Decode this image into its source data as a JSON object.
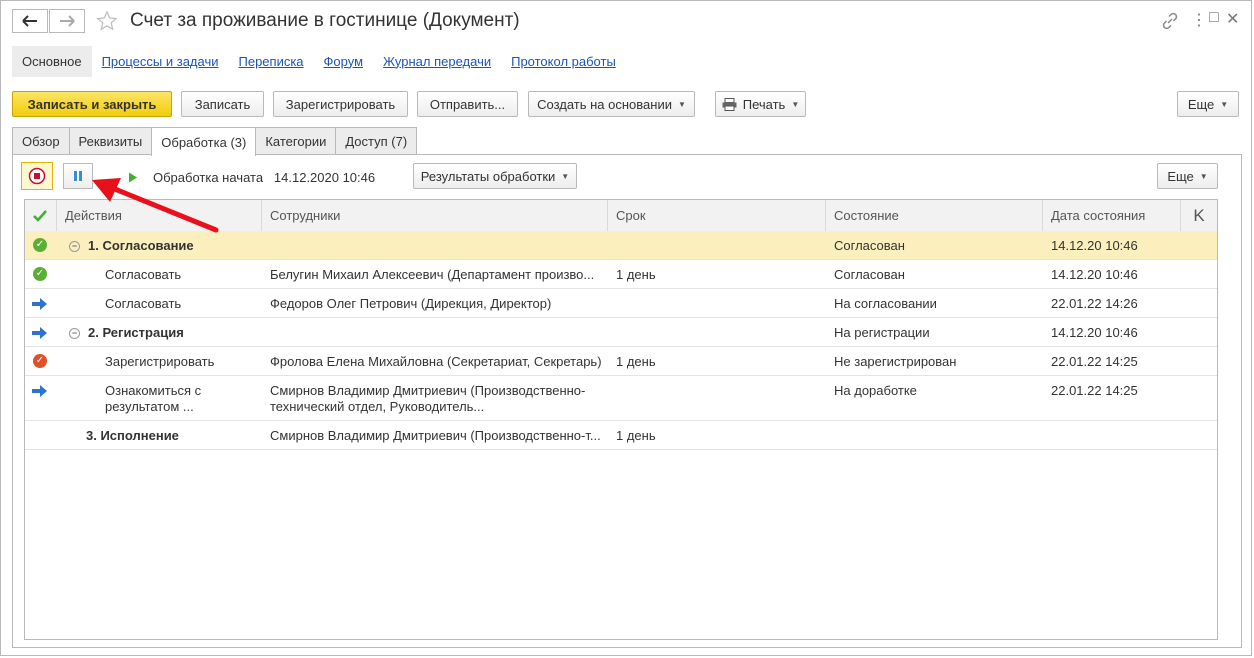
{
  "window": {
    "title": "Счет за проживание в гостинице (Документ)"
  },
  "section_tabs": [
    "Основное",
    "Процессы и задачи",
    "Переписка",
    "Форум",
    "Журнал передачи",
    "Протокол работы"
  ],
  "toolbar": {
    "save_close": "Записать и закрыть",
    "save": "Записать",
    "register": "Зарегистрировать",
    "send": "Отправить...",
    "create_based": "Создать на основании",
    "print": "Печать",
    "more": "Еще"
  },
  "tabs": [
    "Обзор",
    "Реквизиты",
    "Обработка (3)",
    "Категории",
    "Доступ (7)"
  ],
  "processing": {
    "status_label": "Обработка начата",
    "status_date": "14.12.2020 10:46",
    "results_button": "Результаты обработки",
    "more": "Еще"
  },
  "table": {
    "headers": [
      "Действия",
      "Сотрудники",
      "Срок",
      "Состояние",
      "Дата состояния",
      "K"
    ],
    "rows": [
      {
        "icon": "ok",
        "action": "1. Согласование",
        "employee": "",
        "term": "",
        "state": "Согласован",
        "date": "14.12.20 10:46"
      },
      {
        "icon": "ok",
        "action": "Согласовать",
        "employee": "Белугин Михаил Алексеевич (Департамент произво...",
        "term": "1 день",
        "state": "Согласован",
        "date": "14.12.20 10:46"
      },
      {
        "icon": "arrow",
        "action": "Согласовать",
        "employee": "Федоров Олег Петрович (Дирекция, Директор)",
        "term": "",
        "state": "На согласовании",
        "date": "22.01.22 14:26"
      },
      {
        "icon": "arrow",
        "action": "2. Регистрация",
        "employee": "",
        "term": "",
        "state": "На регистрации",
        "date": "14.12.20 10:46"
      },
      {
        "icon": "no",
        "action": "Зарегистрировать",
        "employee": "Фролова Елена Михайловна (Секретариат, Секретарь)",
        "term": "1 день",
        "state": "Не зарегистрирован",
        "date": "22.01.22 14:25"
      },
      {
        "icon": "arrow",
        "action": "Ознакомиться с результатом ...",
        "employee": "Смирнов Владимир Дмитриевич (Производственно-технический отдел, Руководитель...",
        "term": "",
        "state": "На доработке",
        "date": "22.01.22 14:25"
      },
      {
        "icon": "",
        "action": "3. Исполнение",
        "employee": "Смирнов Владимир Дмитриевич (Производственно-т...",
        "term": "1 день",
        "state": "",
        "date": ""
      }
    ]
  },
  "colors": {
    "primary_button": "#f2cc0b",
    "selected_row": "#fbefbd",
    "link": "#1a55b5",
    "annotation_arrow": "#e8101a"
  }
}
